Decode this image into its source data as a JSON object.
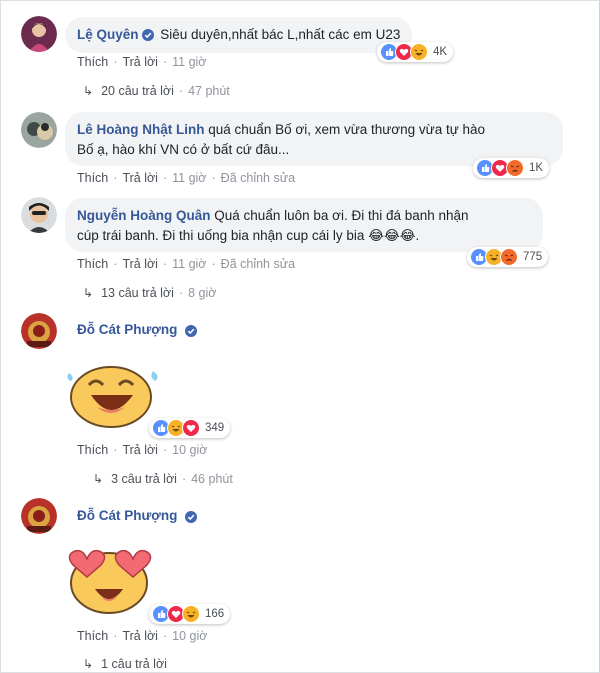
{
  "labels": {
    "like": "Thích",
    "reply": "Trả lời",
    "edited": "Đã chỉnh sửa"
  },
  "comments": [
    {
      "author": "Lệ Quyên",
      "text": "Siêu duyên,nhất bác L,nhất các em U23",
      "time": "11 giờ",
      "reactions": {
        "icons": [
          "like-icon",
          "love-icon",
          "haha-icon"
        ],
        "count": "4K"
      },
      "replies": {
        "label": "20 câu trả lời",
        "time": "47 phút"
      }
    },
    {
      "author": "Lê Hoàng Nhật Linh",
      "text_line1": "quá chuẩn Bố ơi, xem vừa thương vừa tự hào",
      "text_line2": "Bố ạ, hào khí VN có ở bất cứ đâu...",
      "time": "11 giờ",
      "reactions": {
        "icons": [
          "like-icon",
          "love-icon",
          "angry-icon"
        ],
        "count": "1K"
      }
    },
    {
      "author": "Nguyễn Hoàng Quân",
      "text_line1": "Quá chuẩn luôn ba ơi. Đi thi đá banh nhận",
      "text_line2": "cúp trái banh. Đi thi uống bia nhận cup cái ly bia",
      "emoji": "😂😂😂",
      "end": ".",
      "time": "11 giờ",
      "reactions": {
        "icons": [
          "like-icon",
          "haha-icon",
          "angry-icon"
        ],
        "count": "775"
      },
      "replies": {
        "label": "13 câu trả lời",
        "time": "8 giờ"
      }
    },
    {
      "author": "Đỗ Cát Phượng",
      "sticker": "laughing-face-sticker",
      "time": "10 giờ",
      "reactions": {
        "icons": [
          "like-icon",
          "haha-icon",
          "love-icon"
        ],
        "count": "349"
      },
      "replies": {
        "label": "3 câu trả lời",
        "time": "46 phút"
      }
    },
    {
      "author": "Đỗ Cát Phượng",
      "sticker": "heart-eyes-face-sticker",
      "time": "10 giờ",
      "reactions": {
        "icons": [
          "like-icon",
          "love-icon",
          "haha-icon"
        ],
        "count": "166"
      },
      "replies": {
        "label": "1 câu trả lời"
      }
    }
  ],
  "colors": {
    "link": "#365899",
    "like": "#5890ff",
    "love": "#f0284a",
    "haha": "#f7b125",
    "angry": "#f36b2a"
  }
}
